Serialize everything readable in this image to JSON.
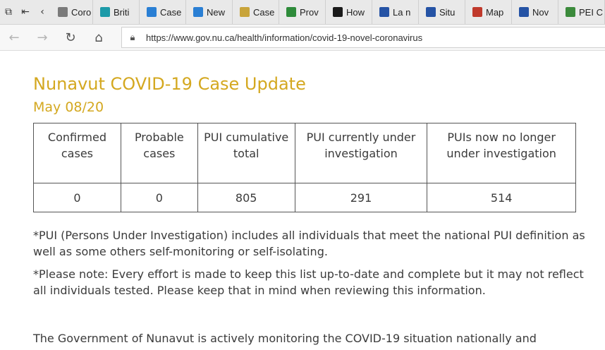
{
  "browser": {
    "tabs": [
      {
        "label": "Coro",
        "icon": "page-icon",
        "color": "#7a7a7a"
      },
      {
        "label": "Briti",
        "icon": "bc-gov-icon",
        "color": "#1c9aa8"
      },
      {
        "label": "Case",
        "icon": "alberta-icon",
        "color": "#2a7fd4"
      },
      {
        "label": "New",
        "icon": "alberta-icon",
        "color": "#2a7fd4"
      },
      {
        "label": "Case",
        "icon": "saskatchewan-icon",
        "color": "#c8a43a"
      },
      {
        "label": "Prov",
        "icon": "manitoba-icon",
        "color": "#2e8b3a"
      },
      {
        "label": "How",
        "icon": "ontario-icon",
        "color": "#1a1a1a"
      },
      {
        "label": "La n",
        "icon": "quebec-icon",
        "color": "#2553a5"
      },
      {
        "label": "Situ",
        "icon": "quebec-icon",
        "color": "#2553a5"
      },
      {
        "label": "Map",
        "icon": "newbrunswick-icon",
        "color": "#c0392b"
      },
      {
        "label": "Nov",
        "icon": "novascotia-icon",
        "color": "#2553a5"
      },
      {
        "label": "PEI C",
        "icon": "pei-icon",
        "color": "#3b8a3b"
      }
    ],
    "url": "https://www.gov.nu.ca/health/information/covid-19-novel-coronavirus"
  },
  "page": {
    "title": "Nunavut COVID-19 Case Update",
    "date": "May 08/20",
    "table": {
      "headers": [
        "Confirmed cases",
        "Probable cases",
        "PUI cumulative total",
        "PUI currently under investigation",
        "PUIs now no longer under investigation"
      ],
      "values": [
        "0",
        "0",
        "805",
        "291",
        "514"
      ]
    },
    "note_pui": "*PUI (Persons Under Investigation) includes all individuals that meet the national PUI definition as well as some others self-monitoring or self-isolating.",
    "note_please": "*Please note: Every effort is made to keep this list up-to-date and complete but it may not reflect all individuals tested. Please keep that in mind when reviewing this information.",
    "paragraph": "The Government of Nunavut is actively monitoring the COVID-19 situation nationally and"
  }
}
